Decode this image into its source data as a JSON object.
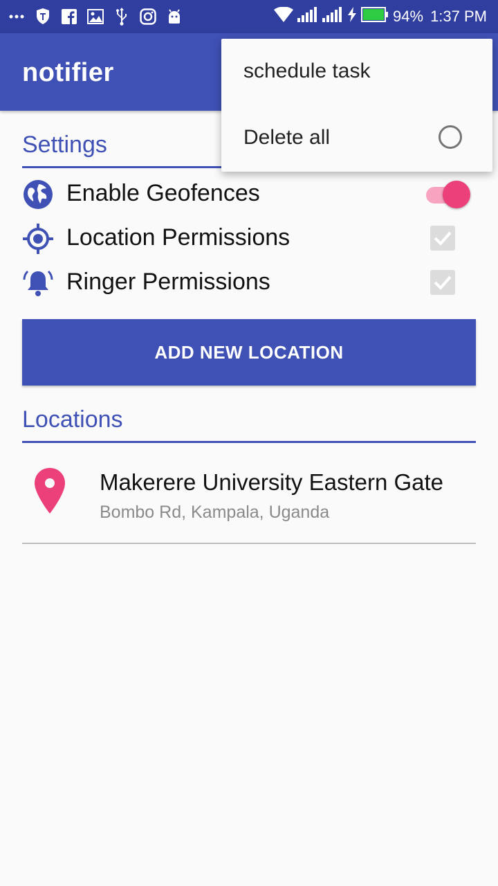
{
  "status_bar": {
    "battery": "94%",
    "time": "1:37 PM",
    "left_icons": [
      "more-dots-icon",
      "shield-icon",
      "facebook-icon",
      "image-icon",
      "usb-icon",
      "instagram-icon",
      "android-icon"
    ],
    "right_icons": [
      "wifi-icon",
      "signal-icon",
      "signal-icon",
      "charging-icon",
      "battery-icon"
    ]
  },
  "app_bar": {
    "title": "notifier"
  },
  "overflow_menu": {
    "items": [
      {
        "label": "schedule task"
      },
      {
        "label": "Delete all",
        "radio_selected": false
      }
    ]
  },
  "settings": {
    "title": "Settings",
    "items": [
      {
        "label": "Enable Geofences",
        "icon": "globe-icon",
        "control": "switch",
        "checked": true
      },
      {
        "label": "Location Permissions",
        "icon": "gps-target-icon",
        "control": "checkbox",
        "checked": true,
        "enabled": false
      },
      {
        "label": "Ringer Permissions",
        "icon": "bell-ringing-icon",
        "control": "checkbox",
        "checked": true,
        "enabled": false
      }
    ]
  },
  "add_button": {
    "label": "ADD NEW LOCATION"
  },
  "locations": {
    "title": "Locations",
    "items": [
      {
        "name": "Makerere University Eastern Gate",
        "address": "Bombo Rd, Kampala, Uganda",
        "icon": "map-pin-icon"
      }
    ]
  },
  "colors": {
    "primary": "#3f51b5",
    "primary_dark": "#303f9f",
    "accent": "#ec407a",
    "background": "#fafafa"
  }
}
